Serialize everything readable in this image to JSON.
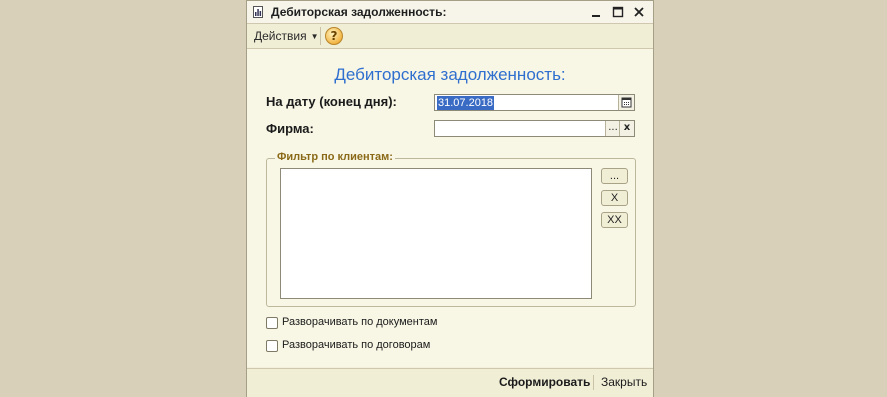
{
  "window": {
    "title": "Дебиторская задолженность:",
    "title_icon": "report-icon",
    "controls": {
      "minimize": "minimize-icon",
      "maximize": "maximize-icon",
      "close": "close-icon"
    }
  },
  "toolbar": {
    "actions_label": "Действия",
    "help_label": "?"
  },
  "form": {
    "heading": "Дебиторская задолженность:",
    "date_label": "На дату (конец дня):",
    "date_value": "31.07.2018",
    "firm_label": "Фирма:",
    "firm_value": "",
    "firm_select_label": "...",
    "firm_clear_label": "x",
    "filter": {
      "legend": "Фильтр по клиентам:",
      "items": [],
      "select_label": "...",
      "remove_label": "X",
      "clear_all_label": "XX"
    },
    "checkboxes": [
      {
        "label": "Разворачивать  по документам",
        "checked": false
      },
      {
        "label": "Разворачивать  по договорам",
        "checked": false
      }
    ]
  },
  "footer": {
    "generate_label": "Сформировать",
    "close_label": "Закрыть"
  },
  "colors": {
    "heading": "#2f6fcf",
    "legend": "#8a6a18",
    "selection": "#3a6bc4",
    "background": "#d8d0b8"
  }
}
